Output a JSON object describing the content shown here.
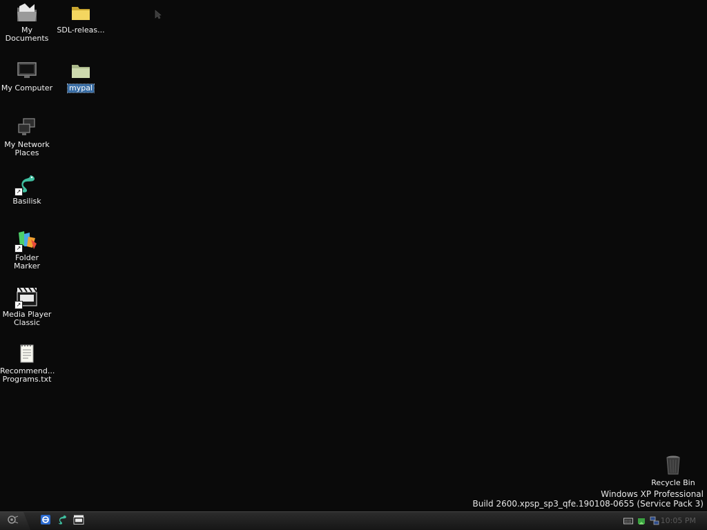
{
  "desktop": {
    "icons": [
      {
        "label": "My\nDocuments",
        "icon": "my-documents-icon"
      },
      {
        "label": "SDL-releas...",
        "icon": "folder-icon"
      },
      {
        "label": "My Computer",
        "icon": "my-computer-icon"
      },
      {
        "label": "mypal",
        "icon": "folder-icon",
        "selected": true
      },
      {
        "label": "My Network\nPlaces",
        "icon": "network-places-icon"
      },
      {
        "label": "Basilisk",
        "icon": "basilisk-icon"
      },
      {
        "label": "Folder\nMarker",
        "icon": "folder-marker-icon"
      },
      {
        "label": "Media Player\nClassic",
        "icon": "media-player-classic-icon"
      },
      {
        "label": "Recommend...\nPrograms.txt",
        "icon": "text-file-icon"
      },
      {
        "label": "Recycle Bin",
        "icon": "recycle-bin-icon"
      }
    ],
    "os_info": {
      "line1": "Windows XP Professional",
      "line2": "Build 2600.xpsp_sp3_qfe.190108-0655 (Service Pack 3)"
    }
  },
  "taskbar": {
    "start_icon": "start-orb-icon",
    "quick_launch": [
      {
        "icon": "internet-explorer-icon"
      },
      {
        "icon": "basilisk-icon"
      },
      {
        "icon": "media-player-classic-icon"
      }
    ],
    "tray": [
      {
        "icon": "keyboard-icon"
      },
      {
        "icon": "safely-remove-hardware-icon"
      },
      {
        "icon": "network-icon"
      }
    ],
    "clock": "10:05 PM"
  },
  "colors": {
    "desktop_background": "#0a0a0a",
    "selection": "#3a6ea5",
    "folder": "#e8c84a"
  }
}
